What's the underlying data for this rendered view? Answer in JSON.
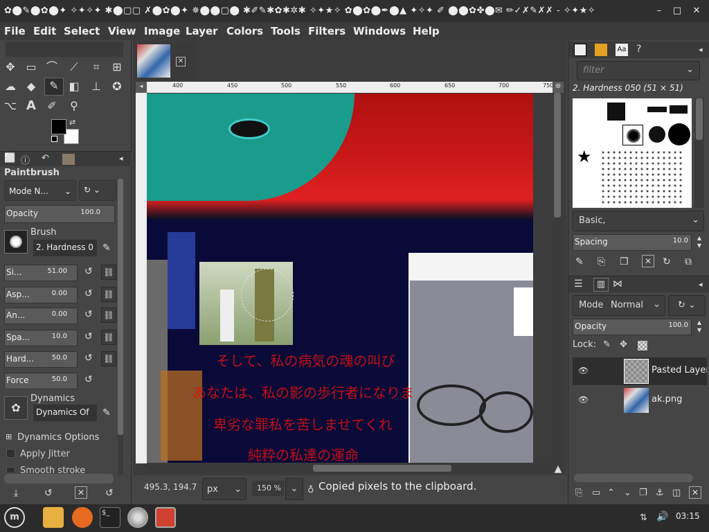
{
  "window": {
    "title": "✿⬤✎⬤✿⬤✦ ✧✦✧✦ ✱⬤▢▢ ✗⬤✿⬤✦ ✵⬤⬤▢⬤ ✱✐✎✱✿✱✲✱ ✧✦★✧ ✿⬤✿⬤✒⬤▲ ✦✧✦ ✐ ⬤⬤✿✤⬤✉ ✏✓✗✎✗✗ - ✧✦★✧",
    "min_label": "–",
    "max_label": "□",
    "close_label": "✕"
  },
  "menu": [
    "File",
    "Edit",
    "Select",
    "View",
    "Image",
    "Layer",
    "Colors",
    "Tools",
    "Filters",
    "Windows",
    "Help"
  ],
  "toolbox": {
    "icons": [
      "move-icon",
      "rect-select-icon",
      "lasso-icon",
      "fuzzy-select-icon",
      "crop-icon",
      "warp-icon",
      "smudge-icon",
      "fill-icon",
      "paintbrush-icon",
      "eraser-icon",
      "clone-icon",
      "heal-icon",
      "paths-icon",
      "text-icon",
      "color-picker-icon",
      "zoom-icon"
    ]
  },
  "tool_options": {
    "title": "Paintbrush",
    "mode_label": "Mode N...",
    "opacity_label": "Opacity",
    "opacity_value": "100.0",
    "brush_label": "Brush",
    "brush_name": "2. Hardness 0",
    "size_label": "Si...",
    "size_value": "51.00",
    "aspect_label": "Asp...",
    "aspect_value": "0.00",
    "angle_label": "An...",
    "angle_value": "0.00",
    "spacing_label": "Spa...",
    "spacing_value": "10.0",
    "hardness_label": "Hard...",
    "hardness_value": "50.0",
    "force_label": "Force",
    "force_value": "50.0",
    "dynamics_label": "Dynamics",
    "dynamics_name": "Dynamics Of",
    "dynamics_options_label": "Dynamics Options",
    "apply_jitter_label": "Apply Jitter",
    "smooth_stroke_label": "Smooth stroke"
  },
  "canvas": {
    "ruler_ticks": [
      "400",
      "450",
      "500",
      "550",
      "600",
      "650",
      "700",
      "750"
    ],
    "jp_lines": [
      "そして、私の病気の魂の叫び",
      "あなたは、私の影の歩行者になりま",
      "卑劣な罪私を苦しませてくれ",
      "純粋の私達の運命"
    ]
  },
  "statusbar": {
    "coords": "495.3, 194.7",
    "unit": "px",
    "zoom": "150 %",
    "message": "Copied pixels to the clipboard."
  },
  "brushes_panel": {
    "filter_placeholder": "filter",
    "brush_title": "2. Hardness 050 (51 × 51)",
    "tag_label": "Basic,",
    "spacing_label": "Spacing",
    "spacing_value": "10.0"
  },
  "layers_panel": {
    "mode_label": "Mode",
    "mode_value": "Normal",
    "opacity_label": "Opacity",
    "opacity_value": "100.0",
    "lock_label": "Lock:",
    "layers": [
      {
        "name": "Pasted Layer"
      },
      {
        "name": "ak.png"
      }
    ]
  },
  "taskbar": {
    "clock": "03:15"
  }
}
